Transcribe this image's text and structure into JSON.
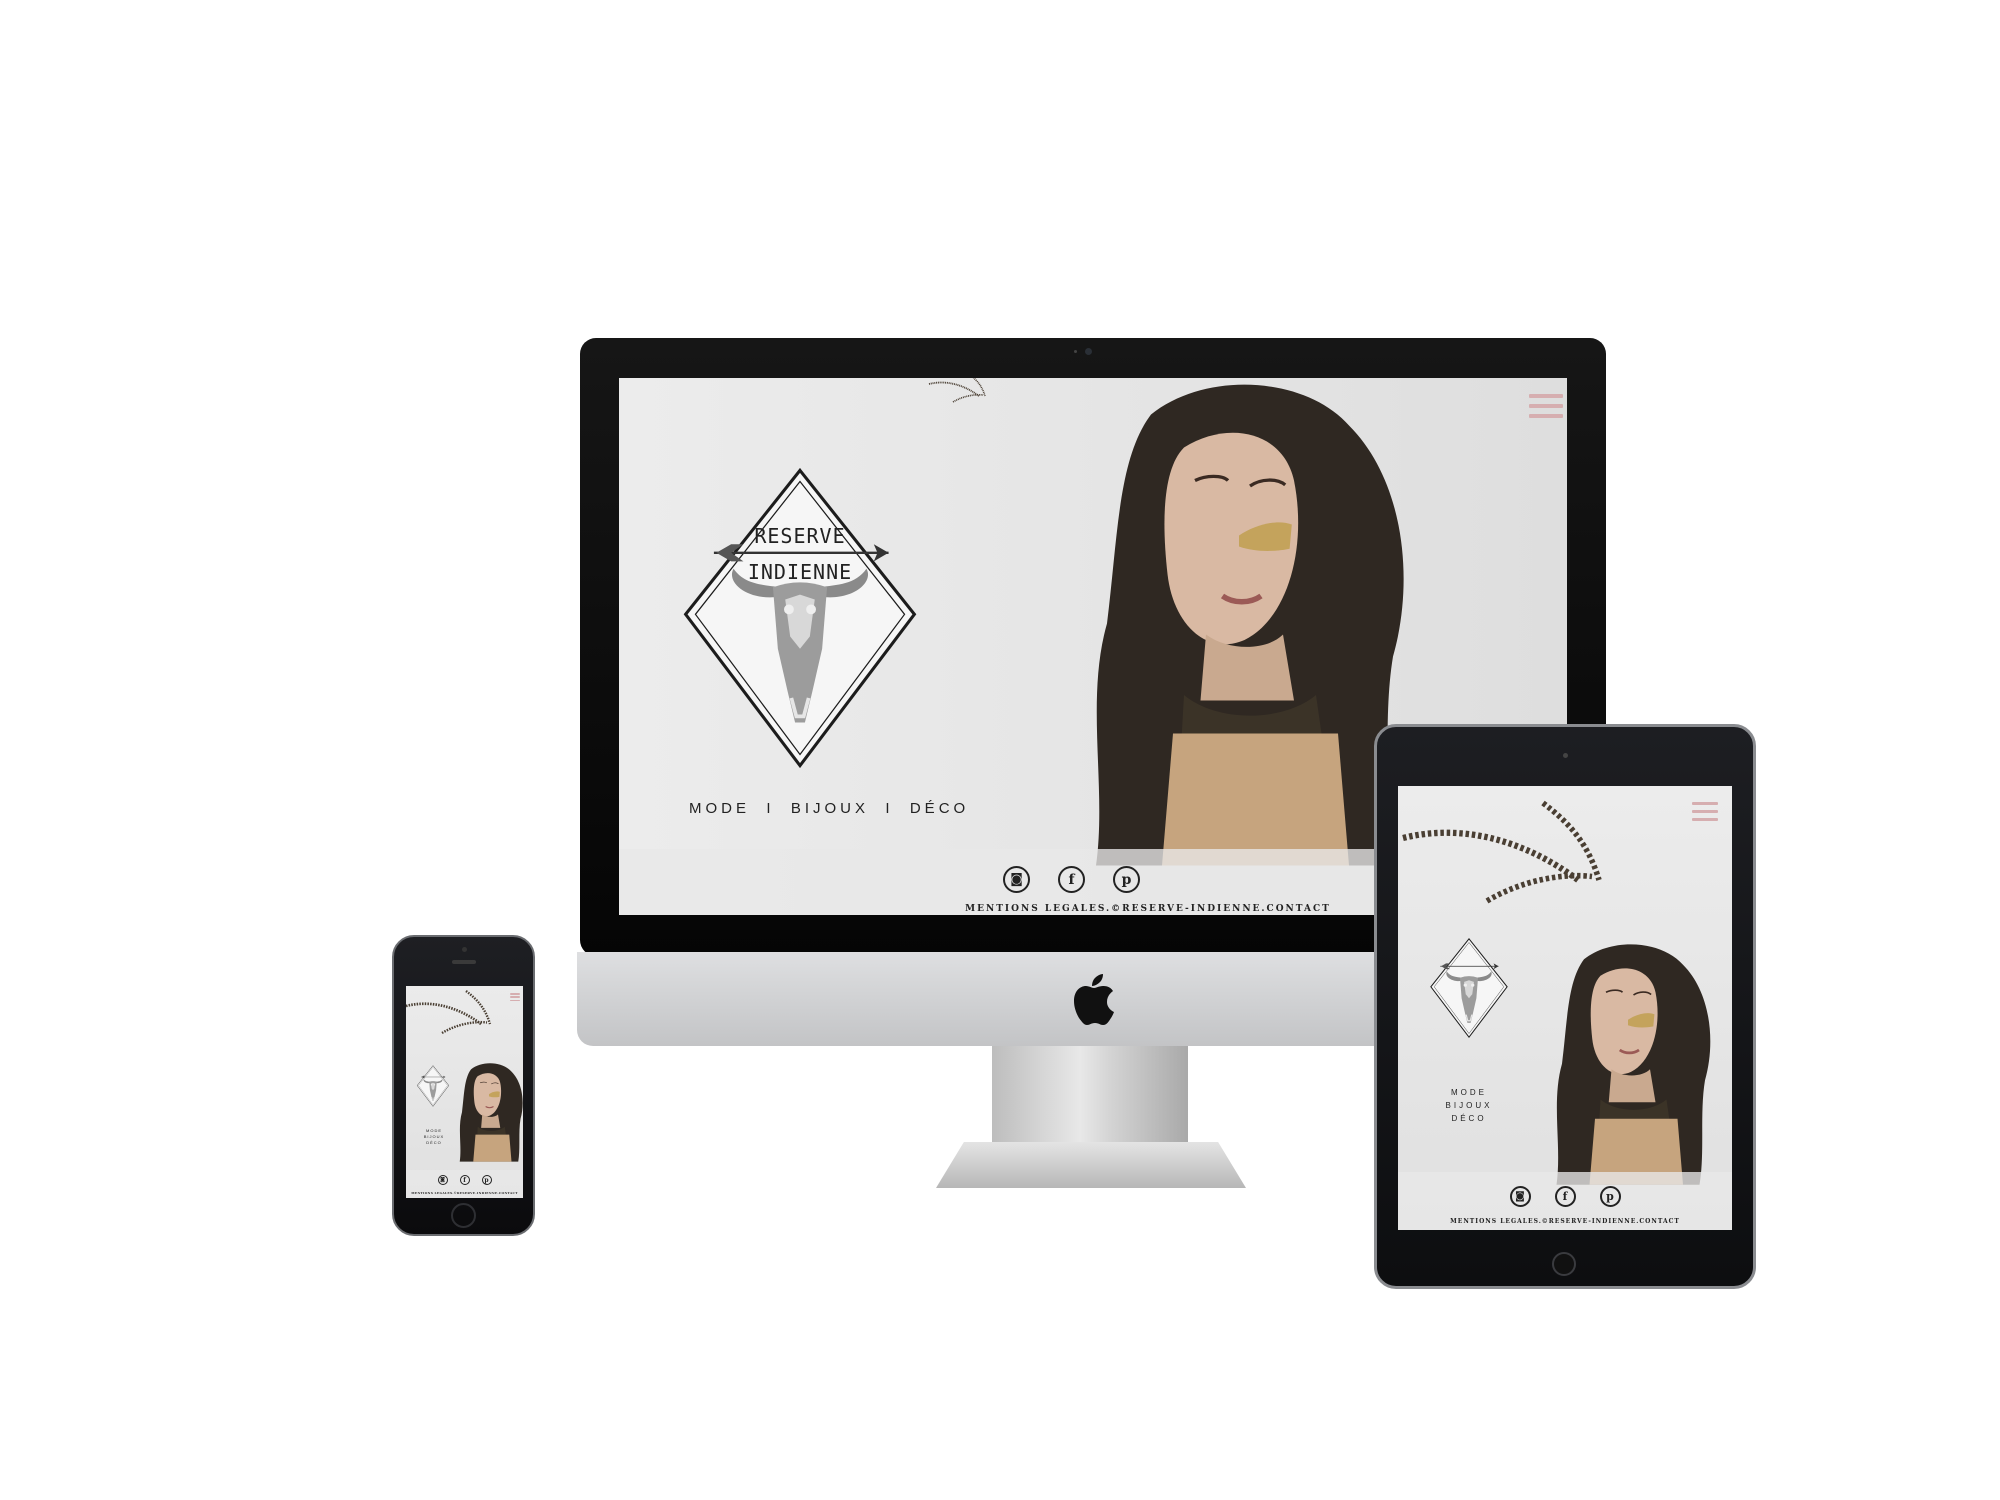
{
  "brand": {
    "logo_line1": "RESERVE",
    "logo_line2": "INDIENNE",
    "accent_color": "#d6aeb0"
  },
  "nav": {
    "desktop_line": "MODE  I  BIJOUX  I  DÉCO",
    "items": [
      "MODE",
      "BIJOUX",
      "DÉCO"
    ]
  },
  "social": [
    {
      "icon": "instagram-icon",
      "glyph": "◙"
    },
    {
      "icon": "facebook-icon",
      "glyph": "f"
    },
    {
      "icon": "pinterest-icon",
      "glyph": "p"
    }
  ],
  "footer": {
    "links_text": "MENTIONS LEGALES.©RESERVE-INDIENNE.CONTACT"
  },
  "menu_icon": "hamburger-menu-icon"
}
